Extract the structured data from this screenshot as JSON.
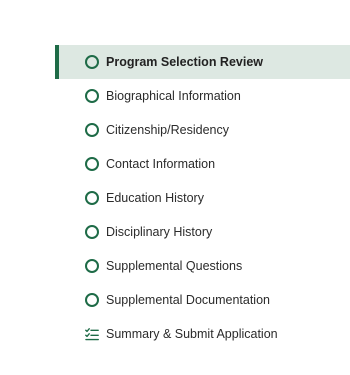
{
  "colors": {
    "accent": "#1e6b47",
    "active_background": "#dde8e2",
    "text": "#2b2b2b"
  },
  "steps": [
    {
      "label": "Program Selection Review",
      "icon": "circle-outline-icon",
      "active": true
    },
    {
      "label": "Biographical Information",
      "icon": "circle-outline-icon",
      "active": false
    },
    {
      "label": "Citizenship/Residency",
      "icon": "circle-outline-icon",
      "active": false
    },
    {
      "label": "Contact Information",
      "icon": "circle-outline-icon",
      "active": false
    },
    {
      "label": "Education History",
      "icon": "circle-outline-icon",
      "active": false
    },
    {
      "label": "Disciplinary History",
      "icon": "circle-outline-icon",
      "active": false
    },
    {
      "label": "Supplemental Questions",
      "icon": "circle-outline-icon",
      "active": false
    },
    {
      "label": "Supplemental Documentation",
      "icon": "circle-outline-icon",
      "active": false
    },
    {
      "label": "Summary & Submit Application",
      "icon": "checklist-icon",
      "active": false
    }
  ]
}
